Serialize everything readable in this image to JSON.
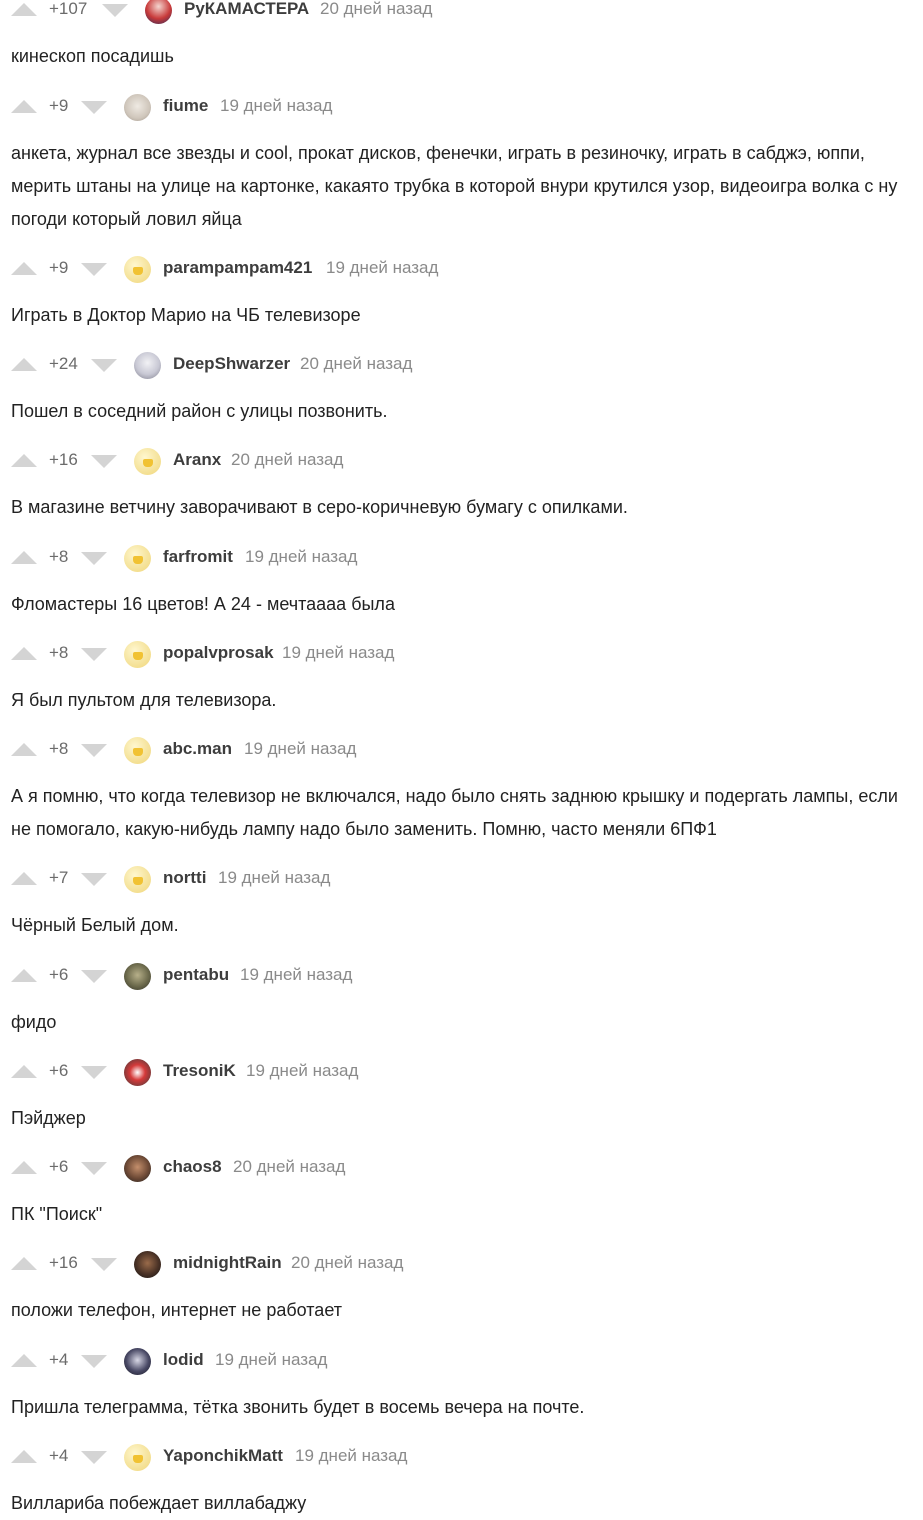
{
  "comments": [
    {
      "rating": "+107",
      "username": "РуКАМАСТЕРА",
      "time": "20 дней назад",
      "text": "кинескоп посадишь",
      "avatar": "red-avatar"
    },
    {
      "rating": "+9",
      "username": "fiume",
      "time": "19 дней назад",
      "text": "анкета, журнал все звезды и cool, прокат дисков, фенечки, играть в резиночку, играть в сабджэ, юппи, мерить штаны на улице на картонке, какаято трубка в которой внури крутился узор, видеоигра волка с ну погоди который ловил яйца",
      "avatar": "cat-avatar"
    },
    {
      "rating": "+9",
      "username": "parampampam421",
      "time": "19 дней назад",
      "text": "Играть в Доктор Марио на ЧБ телевизоре",
      "avatar": "default-avatar"
    },
    {
      "rating": "+24",
      "username": "DeepShwarzer",
      "time": "20 дней назад",
      "text": "Пошел в соседний район с улицы позвонить.",
      "avatar": "anime-avatar"
    },
    {
      "rating": "+16",
      "username": "Aranx",
      "time": "20 дней назад",
      "text": "В магазине ветчину заворачивают в серо-коричневую бумагу с опилками.",
      "avatar": "default-avatar"
    },
    {
      "rating": "+8",
      "username": "farfromit",
      "time": "19 дней назад",
      "text": "Фломастеры 16 цветов! А 24 - мечтаааа была",
      "avatar": "default-avatar"
    },
    {
      "rating": "+8",
      "username": "popalvprosak",
      "time": "19 дней назад",
      "text": "Я был пультом для телевизора.",
      "avatar": "default-avatar"
    },
    {
      "rating": "+8",
      "username": "abc.man",
      "time": "19 дней назад",
      "text": "А я помню, что когда телевизор не включался, надо было снять заднюю крышку и подергать лампы, если не помогало, какую-нибудь лампу надо было заменить. Помню, часто меняли 6ПФ1",
      "avatar": "default-avatar"
    },
    {
      "rating": "+7",
      "username": "nortti",
      "time": "19 дней назад",
      "text": "Чёрный Белый дом.",
      "avatar": "default-avatar"
    },
    {
      "rating": "+6",
      "username": "pentabu",
      "time": "19 дней назад",
      "text": "фидо",
      "avatar": "soldier-avatar"
    },
    {
      "rating": "+6",
      "username": "TresoniK",
      "time": "19 дней назад",
      "text": "Пэйджер",
      "avatar": "car-avatar"
    },
    {
      "rating": "+6",
      "username": "chaos8",
      "time": "20 дней назад",
      "text": "ПК \"Поиск\"",
      "avatar": "glasses-avatar"
    },
    {
      "rating": "+16",
      "username": "midnightRain",
      "time": "20 дней назад",
      "text": "положи телефон, интернет не работает",
      "avatar": "dark-avatar"
    },
    {
      "rating": "+4",
      "username": "lodid",
      "time": "19 дней назад",
      "text": "Пришла телеграмма, тётка звонить будет в восемь вечера на почте.",
      "avatar": "girl-avatar"
    },
    {
      "rating": "+4",
      "username": "YaponchikMatt",
      "time": "19 дней назад",
      "text": "Виллариба побеждает виллабаджу",
      "avatar": "default-avatar"
    }
  ]
}
